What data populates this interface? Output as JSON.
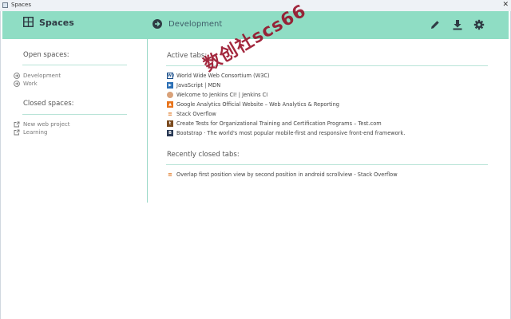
{
  "window": {
    "title": "Spaces"
  },
  "header": {
    "app_name": "Spaces",
    "current_space": "Development",
    "accent_color": "#8fddc4"
  },
  "sidebar": {
    "open_heading": "Open spaces:",
    "open_spaces": [
      {
        "label": "Development",
        "icon": "arrow-circle-icon"
      },
      {
        "label": "Work",
        "icon": "arrow-circle-icon"
      }
    ],
    "closed_heading": "Closed spaces:",
    "closed_spaces": [
      {
        "label": "New web project",
        "icon": "external-link-icon"
      },
      {
        "label": "Learning",
        "icon": "external-link-icon"
      }
    ]
  },
  "main": {
    "active_heading": "Active tabs:",
    "active_tabs": [
      {
        "title": "World Wide Web Consortium (W3C)",
        "icon": "w3c-favicon"
      },
      {
        "title": "JavaScript | MDN",
        "icon": "mdn-favicon"
      },
      {
        "title": "Welcome to Jenkins CI! | Jenkins CI",
        "icon": "jenkins-favicon"
      },
      {
        "title": "Google Analytics Official Website – Web Analytics & Reporting",
        "icon": "google-analytics-favicon"
      },
      {
        "title": "Stack Overflow",
        "icon": "stackoverflow-favicon"
      },
      {
        "title": "Create Tests for Organizational Training and Certification Programs – Test.com",
        "icon": "testcom-favicon"
      },
      {
        "title": "Bootstrap · The world's most popular mobile-first and responsive front-end framework.",
        "icon": "bootstrap-favicon"
      }
    ],
    "closed_heading": "Recently closed tabs:",
    "closed_tabs": [
      {
        "title": "Overlap first position view by second position in android scrollview - Stack Overflow",
        "icon": "stackoverflow-favicon"
      }
    ]
  },
  "watermark": {
    "text": "数创社scs66"
  }
}
